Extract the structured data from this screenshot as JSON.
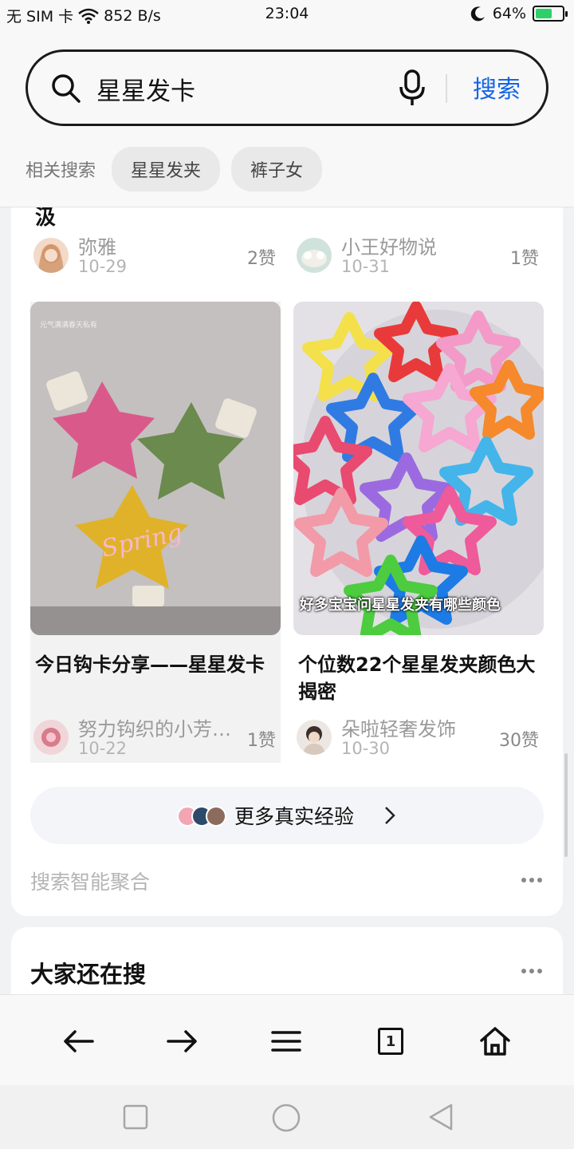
{
  "status_bar": {
    "sim": "无 SIM 卡",
    "net_speed": "852 B/s",
    "time": "23:04",
    "battery": "64%",
    "battery_level": 0.64
  },
  "search": {
    "query": "星星发卡",
    "button_label": "搜索"
  },
  "related": {
    "label": "相关搜索",
    "items": [
      "星星发夹",
      "裤子女"
    ]
  },
  "top_row": {
    "title_tail": "汲",
    "left": {
      "author": "弥雅",
      "date": "10-29",
      "likes": "2赞"
    },
    "right": {
      "author": "小王好物说",
      "date": "10-31",
      "likes": "1赞"
    }
  },
  "posts": [
    {
      "title": "今日钩卡分享——星星发卡",
      "author": "努力钩织的小芳…",
      "date": "10-22",
      "likes": "1赞",
      "image_caption": ""
    },
    {
      "title": "个位数22个星星发夹颜色大揭密",
      "author": "朵啦轻奢发饰",
      "date": "10-30",
      "likes": "30赞",
      "image_caption": "好多宝宝问星星发夹有哪些颜色"
    }
  ],
  "more": {
    "label": "更多真实经验"
  },
  "aggregation": {
    "label": "搜索智能聚合"
  },
  "section2": {
    "title": "大家还在搜"
  },
  "icons": {
    "search": "search-icon",
    "mic": "microphone-icon",
    "back": "arrow-left-icon",
    "forward": "arrow-right-icon",
    "menu": "menu-icon",
    "tabs": "tabs-icon",
    "home": "home-icon"
  },
  "browser_bar": {
    "tab_count": "1"
  },
  "colors": {
    "accent": "#1565e6",
    "battery": "#2ed06a"
  }
}
